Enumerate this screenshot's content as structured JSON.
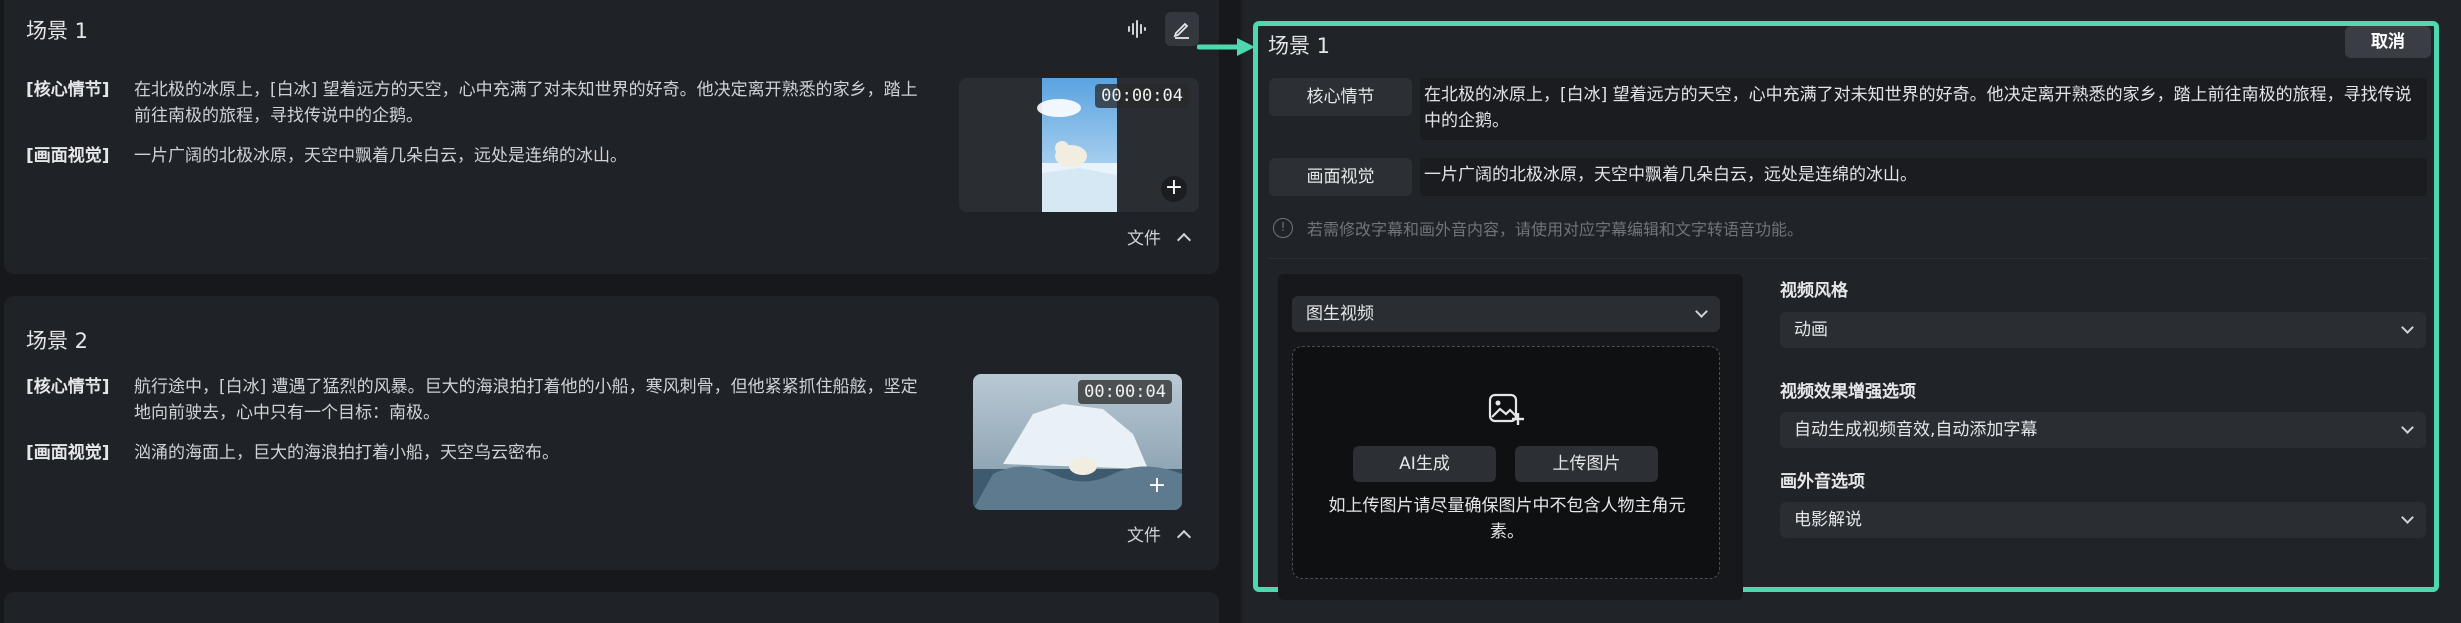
{
  "scenes": [
    {
      "title": "场景 1",
      "plot_label": "[核心情节]",
      "plot_text": "在北极的冰原上，[白冰] 望着远方的天空，心中充满了对未知世界的好奇。他决定离开熟悉的家乡，踏上前往南极的旅程，寻找传说中的企鹅。",
      "visual_label": "[画面视觉]",
      "visual_text": "一片广阔的北极冰原，天空中飘着几朵白云，远处是连绵的冰山。",
      "timecode": "00:00:04",
      "file_label": "文件"
    },
    {
      "title": "场景 2",
      "plot_label": "[核心情节]",
      "plot_text": "航行途中，[白冰] 遭遇了猛烈的风暴。巨大的海浪拍打着他的小船，寒风刺骨，但他紧紧抓住船舷，坚定地向前驶去，心中只有一个目标：南极。",
      "visual_label": "[画面视觉]",
      "visual_text": "汹涌的海面上，巨大的海浪拍打着小船，天空乌云密布。",
      "timecode": "00:00:04",
      "file_label": "文件"
    }
  ],
  "editor": {
    "title": "场景 1",
    "cancel_label": "取消",
    "plot_pill": "核心情节",
    "plot_text": "在北极的冰原上，[白冰] 望着远方的天空，心中充满了对未知世界的好奇。他决定离开熟悉的家乡，踏上前往南极的旅程，寻找传说中的企鹅。",
    "visual_pill": "画面视觉",
    "visual_text": "一片广阔的北极冰原，天空中飘着几朵白云，远处是连绵的冰山。",
    "hint": "若需修改字幕和画外音内容，请使用对应字幕编辑和文字转语音功能。",
    "mode_select": "图生视频",
    "ai_button": "AI生成",
    "upload_button": "上传图片",
    "upload_note": "如上传图片请尽量确保图片中不包含人物主角元素。",
    "style_label": "视频风格",
    "style_value": "动画",
    "enhance_label": "视频效果增强选项",
    "enhance_value": "自动生成视频音效,自动添加字幕",
    "voiceover_label": "画外音选项",
    "voiceover_value": "电影解说"
  },
  "colors": {
    "accent": "#4fd7b0",
    "background": "#1b1d21",
    "card": "#1f2226"
  },
  "icons": [
    "waveform-icon",
    "edit-icon",
    "plus-icon",
    "chevron-up-icon",
    "chevron-down-icon",
    "info-icon",
    "image-add-icon",
    "arrow-right-icon"
  ]
}
